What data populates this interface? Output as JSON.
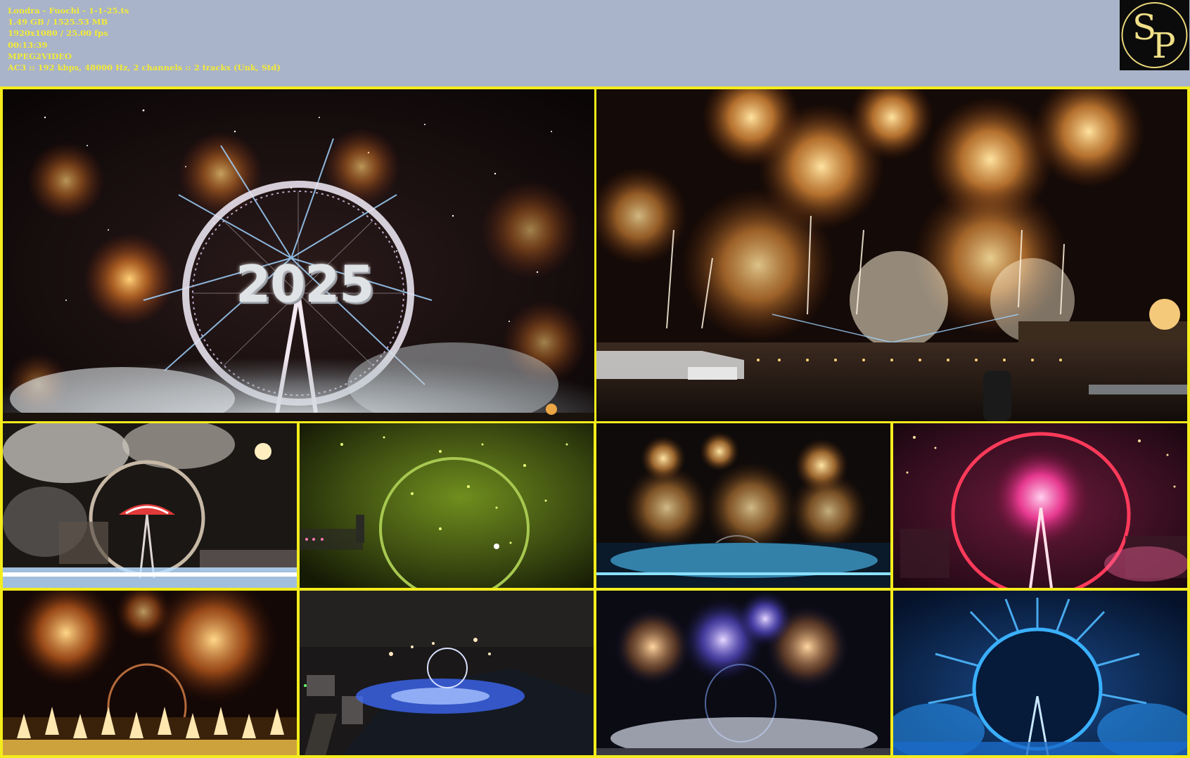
{
  "header": {
    "filename": "Londra - Fuochi - 1-1-25.ts",
    "size": "1.49 GB / 1525.53 MB",
    "resolution": "1920x1080 / 25.00 fps",
    "duration": "00:13:39",
    "video_codec": "MPEG2VIDEO",
    "audio": "AC3 :: 192 kbps, 48000 Hz, 2 channels :: 2 tracks (Unk, Std)"
  },
  "logo": {
    "letters": "SP",
    "color": "#e9d77a"
  },
  "colors": {
    "background": "#a9b3c9",
    "info_text": "#f2ea3a",
    "grid_border": "#f4ec1c"
  },
  "thumbnails": [
    {
      "id": "thumb-1",
      "scene": "wheel-2025-white",
      "overlay_text": "2025"
    },
    {
      "id": "thumb-2",
      "scene": "golden-river-fireworks"
    },
    {
      "id": "thumb-3",
      "scene": "wheel-umbrella"
    },
    {
      "id": "thumb-4",
      "scene": "wheel-green"
    },
    {
      "id": "thumb-5",
      "scene": "golden-bursts-blue-river"
    },
    {
      "id": "thumb-6",
      "scene": "wheel-pink"
    },
    {
      "id": "thumb-7",
      "scene": "wheel-golden-fountains"
    },
    {
      "id": "thumb-8",
      "scene": "aerial-city-blue-river"
    },
    {
      "id": "thumb-9",
      "scene": "blue-purple-bursts"
    },
    {
      "id": "thumb-10",
      "scene": "wheel-blue"
    }
  ]
}
